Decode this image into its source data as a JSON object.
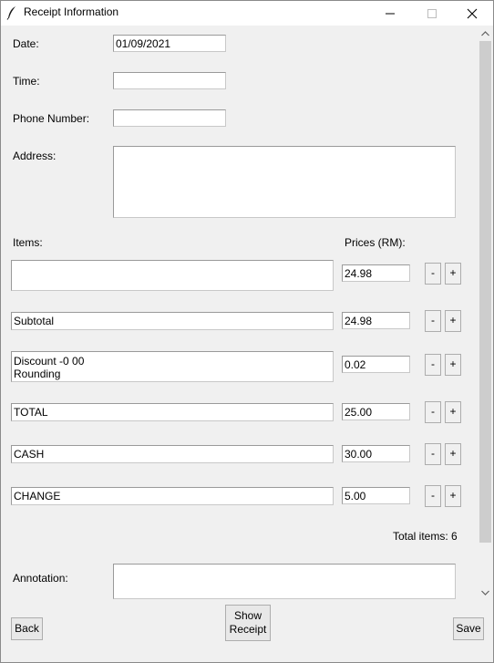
{
  "window": {
    "title": "Receipt Information",
    "icon": "feather-icon"
  },
  "form": {
    "date_label": "Date:",
    "date_value": "01/09/2021",
    "time_label": "Time:",
    "time_value": "",
    "phone_label": "Phone Number:",
    "phone_value": "",
    "address_label": "Address:",
    "address_value": "",
    "items_label": "Items:",
    "prices_label": "Prices (RM):"
  },
  "rows": [
    {
      "item": "",
      "price": "24.98"
    },
    {
      "item": "Subtotal",
      "price": "24.98"
    },
    {
      "item": "Discount -0 00\nRounding",
      "price": "0.02"
    },
    {
      "item": "TOTAL",
      "price": "25.00"
    },
    {
      "item": "CASH",
      "price": "30.00"
    },
    {
      "item": "CHANGE",
      "price": "5.00"
    }
  ],
  "controls": {
    "minus": "-",
    "plus": "+"
  },
  "total_items": "Total items: 6",
  "annotation_label": "Annotation:",
  "annotation_value": "",
  "buttons": {
    "back": "Back",
    "show_receipt": "Show\nReceipt",
    "save": "Save"
  }
}
